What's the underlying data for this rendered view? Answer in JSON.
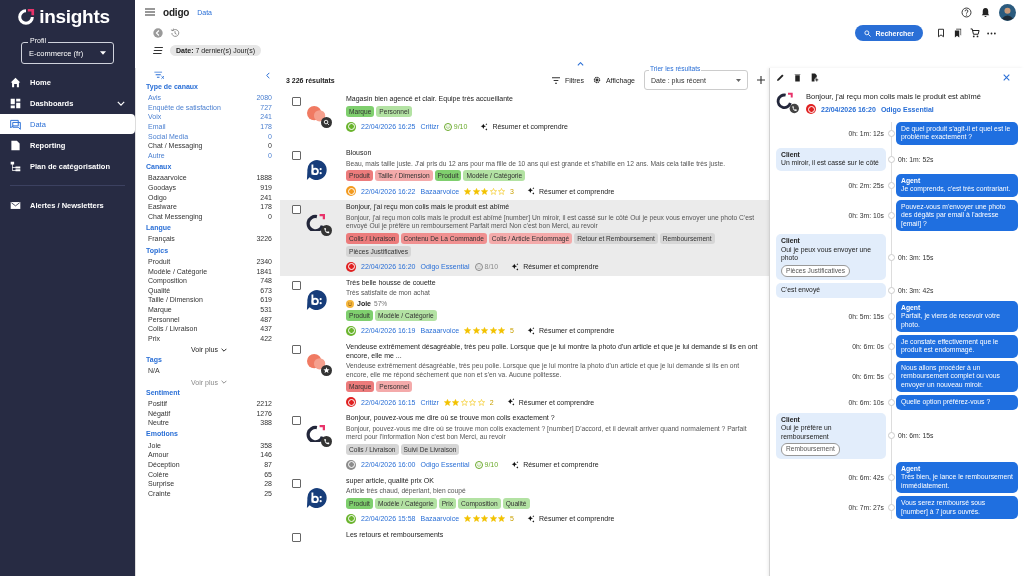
{
  "sidebar": {
    "logo": "insights",
    "profile": {
      "label": "Profil",
      "value": "E-commerce (fr)"
    },
    "nav": [
      {
        "label": "Home",
        "kind": "home",
        "selected": false
      },
      {
        "label": "Dashboards",
        "kind": "dashboard",
        "selected": false,
        "expanded": false
      },
      {
        "label": "Data",
        "kind": "data",
        "selected": true
      },
      {
        "label": "Reporting",
        "kind": "reporting",
        "selected": false
      },
      {
        "label": "Plan de catégorisation",
        "kind": "plan",
        "selected": false
      }
    ],
    "nav_secondary": [
      {
        "label": "Alertes / Newsletters",
        "kind": "mail",
        "selected": false
      }
    ]
  },
  "topbar": {
    "brand": "odigo",
    "page": "Data",
    "search_button": "Rechercher",
    "filter_chip": "**Date:** 7 dernier(s) Jour(s)"
  },
  "filters": {
    "sections": [
      {
        "title": "Type de canaux",
        "items": [
          {
            "label": "Avis",
            "count": "2080",
            "link": true
          },
          {
            "label": "Enquête de satisfaction",
            "count": "727",
            "link": true
          },
          {
            "label": "Voix",
            "count": "241",
            "link": true
          },
          {
            "label": "Email",
            "count": "178",
            "link": true
          },
          {
            "label": "Social Media",
            "count": "0",
            "link": true
          },
          {
            "label": "Chat / Messaging",
            "count": "0",
            "link": false
          },
          {
            "label": "Autre",
            "count": "0",
            "link": true
          }
        ]
      },
      {
        "title": "Canaux",
        "items": [
          {
            "label": "Bazaarvoice",
            "count": "1888"
          },
          {
            "label": "Goodays",
            "count": "919"
          },
          {
            "label": "Odigo",
            "count": "241"
          },
          {
            "label": "Easiware",
            "count": "178"
          },
          {
            "label": "Chat Messenging",
            "count": "0"
          }
        ]
      },
      {
        "title": "Langue",
        "items": [
          {
            "label": "Français",
            "count": "3226"
          }
        ]
      },
      {
        "title": "Topics",
        "items": [
          {
            "label": "Produit",
            "count": "2340"
          },
          {
            "label": "Modèle / Catégorie",
            "count": "1841"
          },
          {
            "label": "Composition",
            "count": "748"
          },
          {
            "label": "Qualité",
            "count": "673"
          },
          {
            "label": "Taille / Dimension",
            "count": "619"
          },
          {
            "label": "Marque",
            "count": "531"
          },
          {
            "label": "Personnel",
            "count": "487"
          },
          {
            "label": "Colis / Livraison",
            "count": "437"
          },
          {
            "label": "Prix",
            "count": "422"
          }
        ],
        "more": {
          "label": "Voir plus",
          "disabled": false
        }
      },
      {
        "title": "Tags",
        "items": [
          {
            "label": "N/A"
          }
        ],
        "more": {
          "label": "Voir plus",
          "disabled": true
        }
      },
      {
        "title": "Sentiment",
        "items": [
          {
            "label": "Positif",
            "count": "2212"
          },
          {
            "label": "Négatif",
            "count": "1276"
          },
          {
            "label": "Neutre",
            "count": "388"
          }
        ]
      },
      {
        "title": "Emotions",
        "items": [
          {
            "label": "Joie",
            "count": "358"
          },
          {
            "label": "Amour",
            "count": "146"
          },
          {
            "label": "Déception",
            "count": "87"
          },
          {
            "label": "Colère",
            "count": "65"
          },
          {
            "label": "Surprise",
            "count": "28"
          },
          {
            "label": "Crainte",
            "count": "25"
          }
        ]
      }
    ]
  },
  "results": {
    "count": "3 226 résultats",
    "filters_button": "Filtres",
    "display_button": "Affichage",
    "sort": {
      "label": "Trier les résultats",
      "value": "Date : plus récent"
    },
    "items": [
      {
        "kind": "critizr",
        "badge": {
          "kind": "search"
        },
        "checked": false,
        "selected": false,
        "title": "Magasin bien agencé et clair. Equipe très accueillante",
        "tags": [
          {
            "label": "Marque",
            "color": "#7fcf6e"
          },
          {
            "label": "Personnel",
            "color": "#b3e2a3"
          }
        ],
        "sentiment": {
          "color": "#6ab42d"
        },
        "date": "22/04/2026 16:25",
        "channel": "Critizr",
        "rating": {
          "kind": "score",
          "value": "9/10",
          "positive": true
        },
        "action": "Résumer et comprendre"
      },
      {
        "kind": "bazaarvoice",
        "checked": false,
        "selected": false,
        "title": "Blouson",
        "excerpt": "Beau, mais taille juste. J'ai pris du 12 ans pour ma fille de 10 ans qui est grande et s'habille en 12 ans. Mais cela taille très juste.",
        "tags": [
          {
            "label": "Produit",
            "color": "#ec7b7b"
          },
          {
            "label": "Taille / Dimension",
            "color": "#f4aaaa"
          },
          {
            "label": "Produit",
            "color": "#7fcf6e"
          },
          {
            "label": "Modèle / Catégorie",
            "color": "#b3e2a3"
          }
        ],
        "sentiment": {
          "color": "#f39a1e"
        },
        "date": "22/04/2026 16:22",
        "channel": "Bazaarvoice",
        "rating": {
          "kind": "stars",
          "stars": 3,
          "value": "3"
        },
        "action": "Résumer et comprendre"
      },
      {
        "kind": "odigo",
        "badge": {
          "kind": "phone"
        },
        "checked": false,
        "selected": true,
        "title": "Bonjour, j'ai reçu mon colis mais le produit est abîmé",
        "excerpt": "Bonjour, j'ai reçu mon colis mais le produit est abîmé [number] Un miroir, il est cassé sur le côté Oui je peux vous envoyer une photo C'est envoyé Oui je préfère un remboursement Parfait merci Non c'est bon Merci, au revoir",
        "tags": [
          {
            "label": "Colis / Livraison",
            "color": "#ec7b7b"
          },
          {
            "label": "Contenu De La Commande",
            "color": "#f09090"
          },
          {
            "label": "Colis / Article Endommagé",
            "color": "#f4aaaa"
          },
          {
            "label": "Retour et Remboursement",
            "color": "#d6d6d6"
          },
          {
            "label": "Remboursement",
            "color": "#d6d6d6"
          },
          {
            "label": "Pièces Justificatives",
            "color": "#d6d6d6"
          }
        ],
        "sentiment": {
          "color": "#e02020"
        },
        "date": "22/04/2026 16:20",
        "channel": "Odigo Essential",
        "rating": {
          "kind": "score",
          "value": "8/10",
          "positive": false
        },
        "action": "Résumer et comprendre"
      },
      {
        "kind": "bazaarvoice",
        "checked": false,
        "selected": false,
        "title": "Très belle housse de couette",
        "excerpt": "Très satisfaite de mon achat",
        "emotion": {
          "label": "Joie",
          "score": "57%"
        },
        "tags": [
          {
            "label": "Produit",
            "color": "#7fcf6e"
          },
          {
            "label": "Modèle / Catégorie",
            "color": "#b3e2a3"
          }
        ],
        "sentiment": {
          "color": "#6ab42d"
        },
        "date": "22/04/2026 16:19",
        "channel": "Bazaarvoice",
        "rating": {
          "kind": "stars",
          "stars": 5,
          "value": "5"
        },
        "action": "Résumer et comprendre"
      },
      {
        "kind": "critizr",
        "badge": {
          "kind": "star"
        },
        "checked": false,
        "selected": false,
        "title": "Vendeuse extrêmement désagréable, très peu polie. Lorsque que je lui montre la photo d'un article et que je lui demande si ils en ont encore, elle me ...",
        "excerpt": "Vendeuse extrêmement désagréable, très peu polie. Lorsque que je lui montre la photo d'un article et que je lui demande si ils en ont encore, elle me répond sèchement que non et s'en va. Aucune politesse.",
        "tags": [
          {
            "label": "Marque",
            "color": "#ec7b7b"
          },
          {
            "label": "Personnel",
            "color": "#f4aaaa"
          }
        ],
        "sentiment": {
          "color": "#e02020"
        },
        "date": "22/04/2026 16:15",
        "channel": "Critizr",
        "rating": {
          "kind": "stars",
          "stars": 2,
          "value": "2"
        },
        "action": "Résumer et comprendre"
      },
      {
        "kind": "odigo",
        "badge": {
          "kind": "phone"
        },
        "checked": false,
        "selected": false,
        "title": "Bonjour, pouvez-vous me dire où se trouve mon colis exactement ?",
        "excerpt": "Bonjour, pouvez-vous me dire où se trouve mon colis exactement ? [number] D'accord, et il devrait arriver quand normalement ? Parfait merci pour l'information Non c'est bon Merci, au revoir",
        "tags": [
          {
            "label": "Colis / Livraison",
            "color": "#d6d6d6"
          },
          {
            "label": "Suivi De Livraison",
            "color": "#d6d6d6"
          }
        ],
        "sentiment": {
          "color": "#8c8c8c"
        },
        "date": "22/04/2026 16:00",
        "channel": "Odigo Essential",
        "rating": {
          "kind": "score",
          "value": "9/10",
          "positive": true
        },
        "action": "Résumer et comprendre"
      },
      {
        "kind": "bazaarvoice",
        "checked": false,
        "selected": false,
        "title": "super article, qualité prix OK",
        "excerpt": "Article très chaud, déperlant, bien coupé",
        "tags": [
          {
            "label": "Produit",
            "color": "#7fcf6e"
          },
          {
            "label": "Modèle / Catégorie",
            "color": "#b3e2a3"
          },
          {
            "label": "Prix",
            "color": "#b3e2a3"
          },
          {
            "label": "Composition",
            "color": "#b3e2a3"
          },
          {
            "label": "Qualité",
            "color": "#b3e2a3"
          }
        ],
        "sentiment": {
          "color": "#6ab42d"
        },
        "date": "22/04/2026 15:58",
        "channel": "Bazaarvoice",
        "rating": {
          "kind": "stars",
          "stars": 5,
          "value": "5"
        },
        "action": "Résumer et comprendre"
      },
      {
        "kind": "none",
        "checked": false,
        "selected": false,
        "title": "Les retours et remboursements"
      }
    ]
  },
  "detail": {
    "title": "Bonjour, j'ai reçu mon colis mais le produit est abîmé",
    "sentiment": {
      "color": "#e02020"
    },
    "date": "22/04/2026 16:20",
    "channel": "Odigo Essential",
    "messages": [
      {
        "kind": "agent",
        "text": "De quel produit s'agit-il et quel est le problème exactement ?",
        "time": "0h: 1m: 12s"
      },
      {
        "kind": "client",
        "speaker": "Client",
        "text": "Un miroir, il est cassé sur le côté",
        "time": "0h: 1m: 52s"
      },
      {
        "kind": "agent",
        "speaker": "Agent",
        "text": "Je comprends, c'est très contrariant.",
        "time": "0h: 2m: 25s"
      },
      {
        "kind": "agent",
        "text": "Pouvez-vous m'envoyer une photo des dégâts par email à l'adresse [email] ?",
        "time": "0h: 3m: 10s"
      },
      {
        "kind": "client",
        "speaker": "Client",
        "text": "Oui je peux vous envoyer une photo",
        "tag": "Pièces Justificatives",
        "time": "0h: 3m: 15s"
      },
      {
        "kind": "client",
        "text": "C'est envoyé",
        "time": "0h: 3m: 42s"
      },
      {
        "kind": "agent",
        "speaker": "Agent",
        "text": "Parfait, je viens de recevoir votre photo.",
        "time": "0h: 5m: 15s"
      },
      {
        "kind": "agent",
        "text": "Je constate effectivement que le produit est endommagé.",
        "time": "0h: 6m: 0s"
      },
      {
        "kind": "agent",
        "text": "Nous allons procéder à un remboursement complet ou vous envoyer un nouveau miroir.",
        "time": "0h: 6m: 5s"
      },
      {
        "kind": "agent",
        "text": "Quelle option préférez-vous ?",
        "time": "0h: 6m: 10s"
      },
      {
        "kind": "client",
        "speaker": "Client",
        "text": "Oui je préfère un remboursement",
        "tag": "Remboursement",
        "time": "0h: 6m: 15s"
      },
      {
        "kind": "agent",
        "speaker": "Agent",
        "text": "Très bien, je lance le remboursement immédiatement.",
        "time": "0h: 6m: 42s"
      },
      {
        "kind": "agent",
        "text": "Vous serez remboursé sous [number] à 7 jours ouvrés.",
        "time": "0h: 7m: 27s"
      }
    ]
  }
}
